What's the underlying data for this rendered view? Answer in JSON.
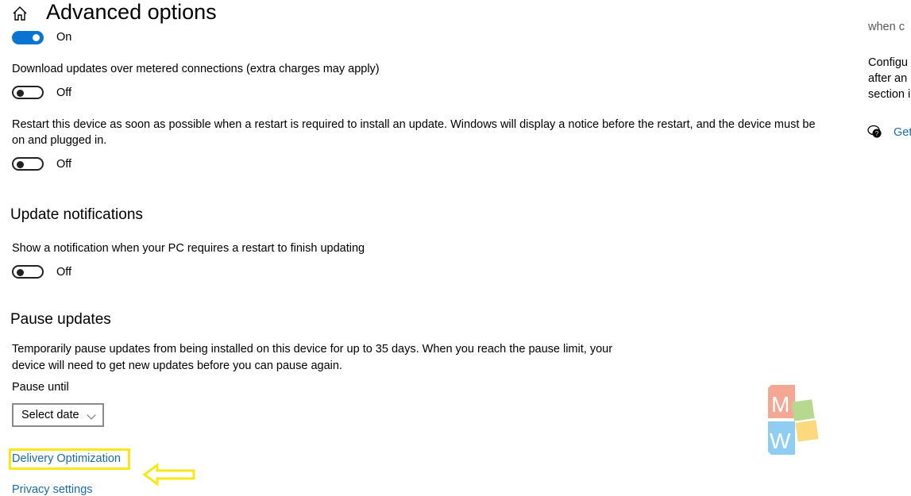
{
  "header": {
    "title": "Advanced options",
    "home_icon": "home-icon"
  },
  "settings": [
    {
      "id": "top",
      "state": "On",
      "on": true
    },
    {
      "id": "metered",
      "label": "Download updates over metered connections (extra charges may apply)",
      "state": "Off",
      "on": false
    },
    {
      "id": "restart",
      "label_line1": "Restart this device as soon as possible when a restart is required to install an update. Windows will display a notice before the restart, and the device must be",
      "label_line2": "on and plugged in.",
      "state": "Off",
      "on": false
    }
  ],
  "notifications": {
    "heading": "Update notifications",
    "label": "Show a notification when your PC requires a restart to finish updating",
    "state": "Off"
  },
  "pause": {
    "heading": "Pause updates",
    "desc_line1": "Temporarily pause updates from being installed on this device for up to 35 days. When you reach the pause limit, your",
    "desc_line2": "device will need to get new updates before you can pause again.",
    "pause_until_label": "Pause until",
    "select_value": "Select date"
  },
  "links": {
    "delivery_optimization": "Delivery Optimization",
    "privacy_settings": "Privacy settings"
  },
  "sidebar": {
    "partial_top": "when c",
    "line1": "Configu",
    "line2": "after an",
    "line3": "section i",
    "help_link": "Get"
  },
  "colors": {
    "accent": "#0a74d2",
    "link": "#1a6aa8",
    "highlight": "#f7e81a"
  }
}
